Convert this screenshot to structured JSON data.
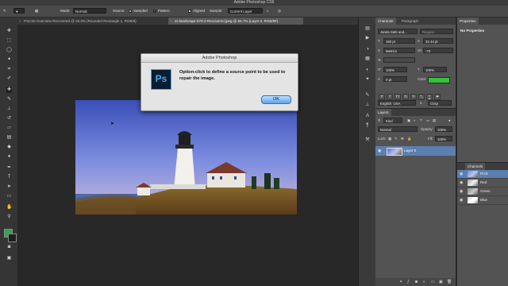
{
  "app": {
    "title": "Adobe Photoshop CS6"
  },
  "options_bar": {
    "mode_label": "Mode:",
    "mode_value": "Normal",
    "source_label": "Source:",
    "sampled_label": "Sampled",
    "pattern_label": "Pattern:",
    "aligned_label": "Aligned",
    "sample_label": "Sample:",
    "sample_value": "Current Layer"
  },
  "doc_tabs": [
    {
      "label": "PSCS6 Overview-Recovered @ 33.3% (Rounded Rectangle 1, RGB/8)"
    },
    {
      "label": "ss-landscape-579-2-Recovered.jpeg @ 66.7% (Layer 0, RGB/8#)"
    }
  ],
  "dialog": {
    "title": "Adobe Photoshop",
    "icon_text": "Ps",
    "message": "Option-click to define a source point to be used to repair the image.",
    "ok_label": "OK"
  },
  "character_panel": {
    "tabs": [
      "Character",
      "Paragraph"
    ],
    "font_family": "Janda Safe and...",
    "font_style": "Regular",
    "font_size": "150 pt",
    "leading": "32.44 pt",
    "kerning": "Metrics",
    "tracking": "-70",
    "baseline_shift": "0 pt",
    "vscale": "100%",
    "hscale": "100%",
    "color_label": "Color:",
    "color_value": "#35c23a",
    "language": "English: USA",
    "antialias_a": "a",
    "antialias": "Crisp"
  },
  "layers_panel": {
    "title": "Layers",
    "filter_label": "Kind",
    "blend_mode": "Normal",
    "opacity_label": "Opacity:",
    "opacity_value": "100%",
    "lock_label": "Lock:",
    "fill_label": "Fill:",
    "fill_value": "100%",
    "layer_name": "Layer 0"
  },
  "properties_panel": {
    "title": "Properties",
    "message": "No Properties"
  },
  "channels_panel": {
    "title": "Channels",
    "channels": [
      {
        "name": "RGB"
      },
      {
        "name": "Red"
      },
      {
        "name": "Green"
      },
      {
        "name": "Blue"
      }
    ]
  },
  "colors": {
    "foreground": "#2ea84a",
    "background": "#1f1f1f"
  }
}
